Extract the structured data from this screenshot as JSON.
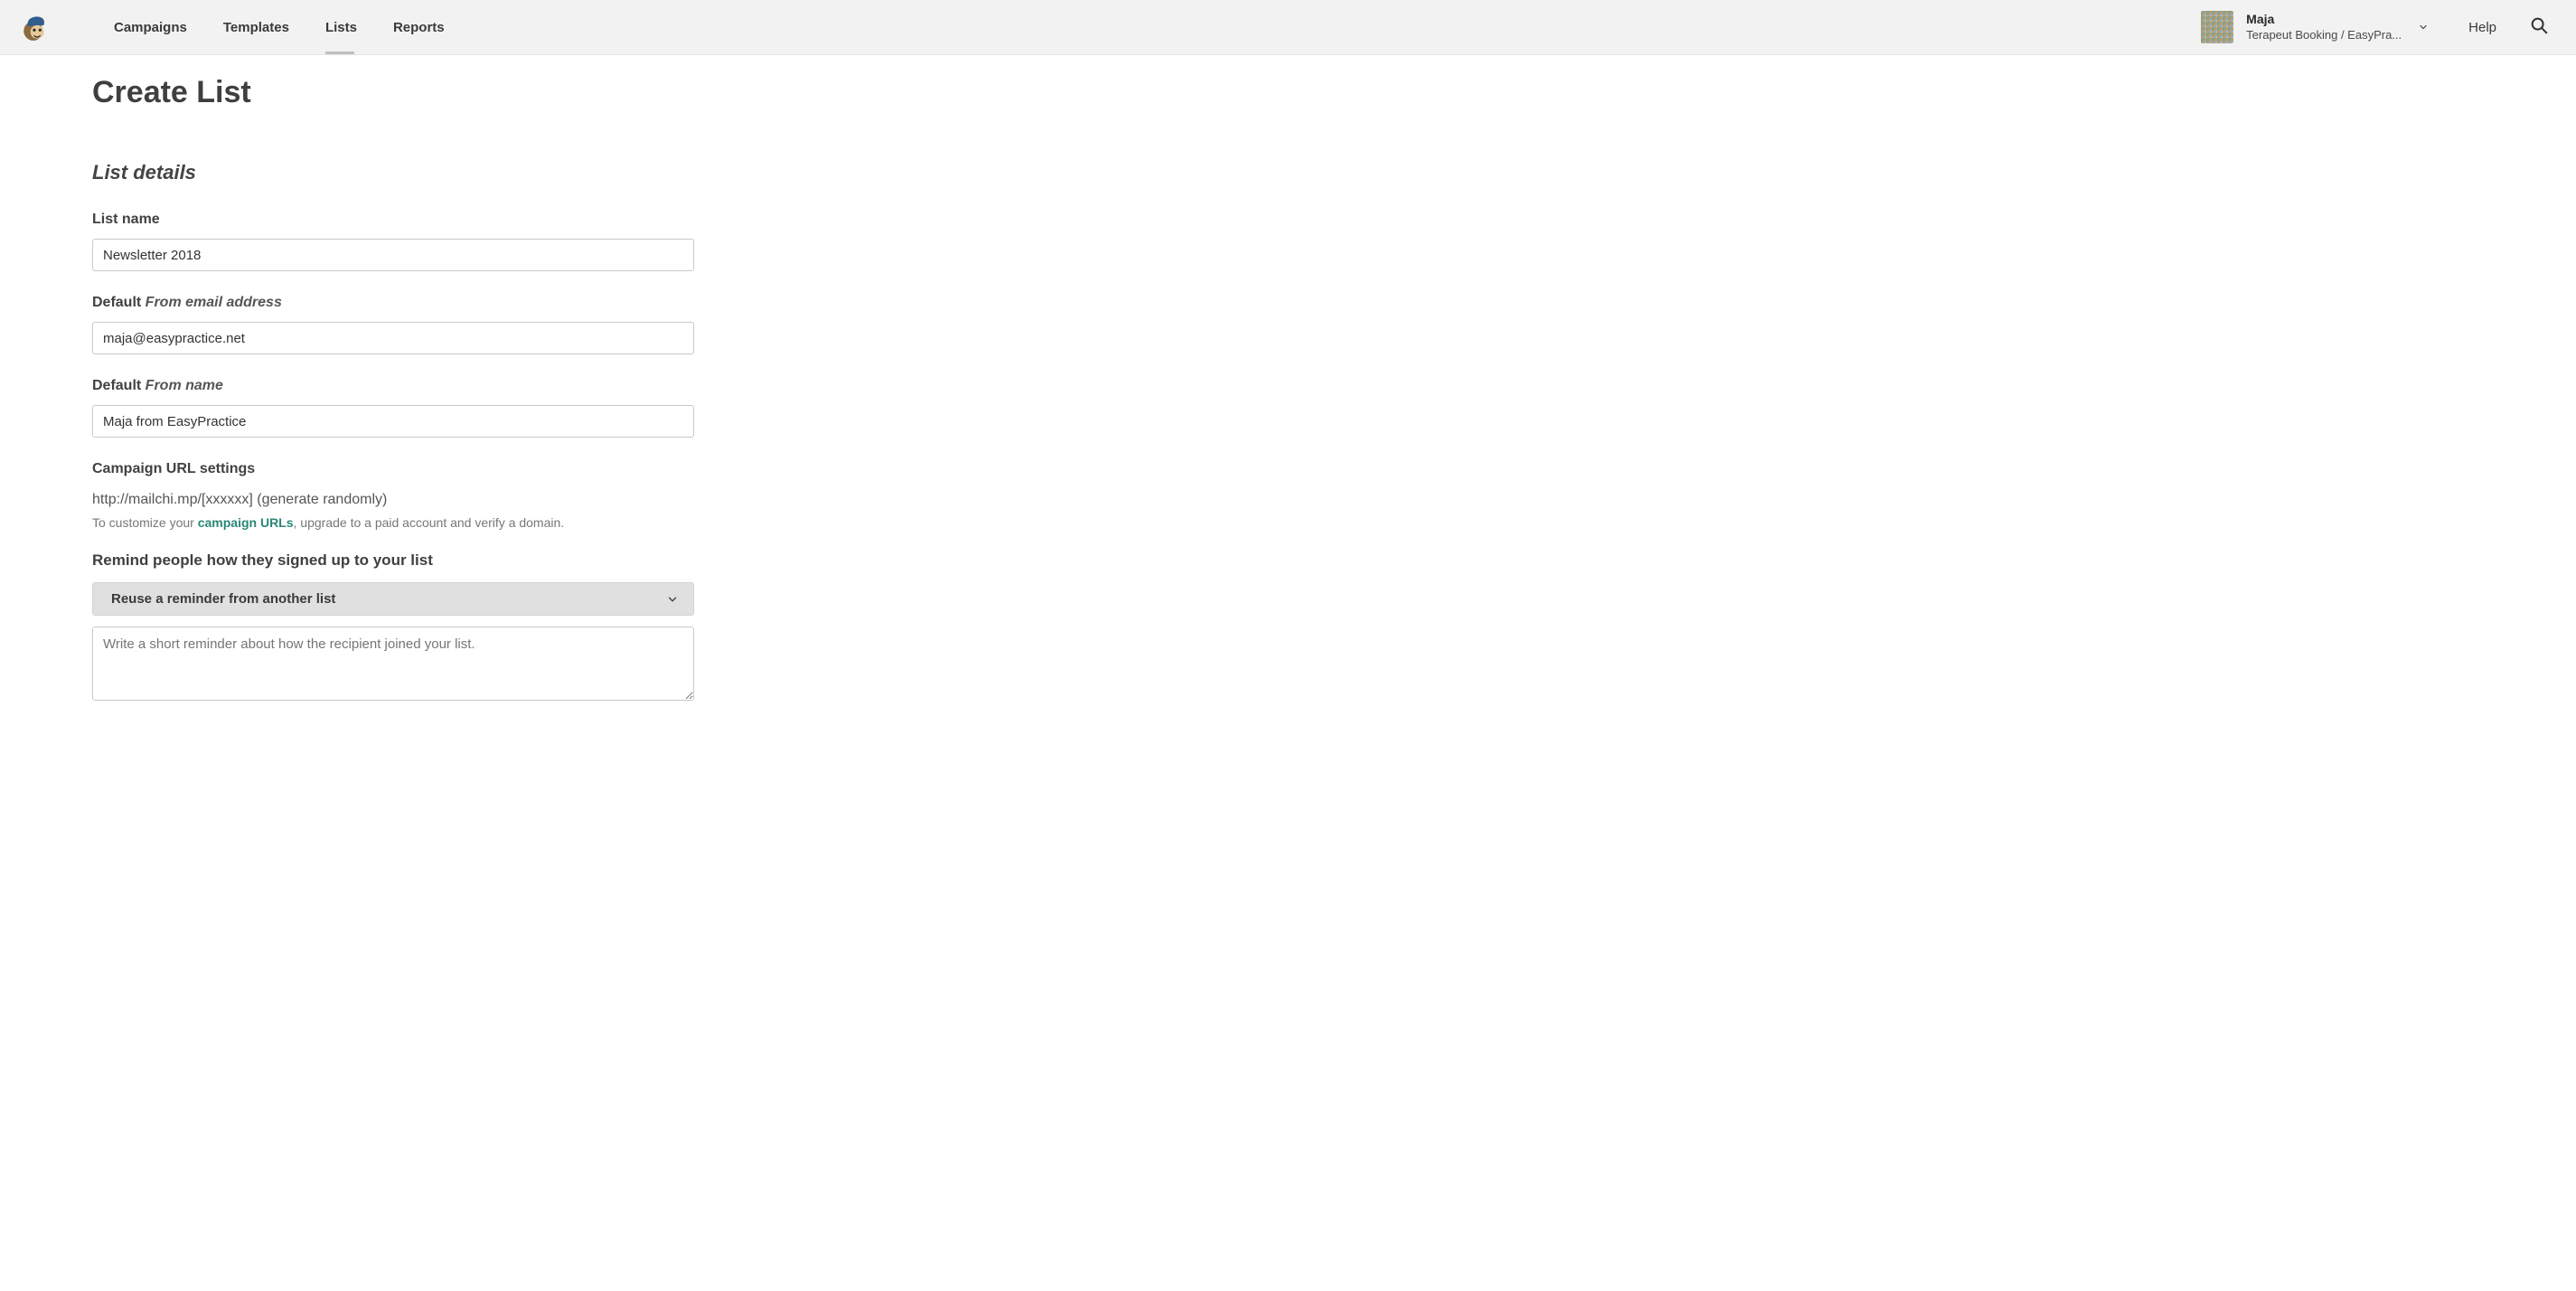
{
  "nav": {
    "items": [
      {
        "label": "Campaigns",
        "active": false
      },
      {
        "label": "Templates",
        "active": false
      },
      {
        "label": "Lists",
        "active": true
      },
      {
        "label": "Reports",
        "active": false
      }
    ]
  },
  "user": {
    "name": "Maja",
    "org": "Terapeut Booking / EasyPra..."
  },
  "help_label": "Help",
  "page": {
    "title": "Create List",
    "section_heading": "List details"
  },
  "fields": {
    "list_name": {
      "label": "List name",
      "value": "Newsletter 2018"
    },
    "from_email": {
      "label_prefix": "Default ",
      "label_italic": "From email address",
      "value": "maja@easypractice.net"
    },
    "from_name": {
      "label_prefix": "Default ",
      "label_italic": "From name",
      "value": "Maja from EasyPractice"
    },
    "campaign_url": {
      "label": "Campaign URL settings",
      "url_line": "http://mailchi.mp/[xxxxxx] (generate randomly)",
      "help_pre": "To customize your ",
      "help_link": "campaign URLs",
      "help_post": ", upgrade to a paid account and verify a domain."
    },
    "reminder": {
      "label": "Remind people how they signed up to your list",
      "select_label": "Reuse a reminder from another list",
      "placeholder": "Write a short reminder about how the recipient joined your list."
    }
  }
}
